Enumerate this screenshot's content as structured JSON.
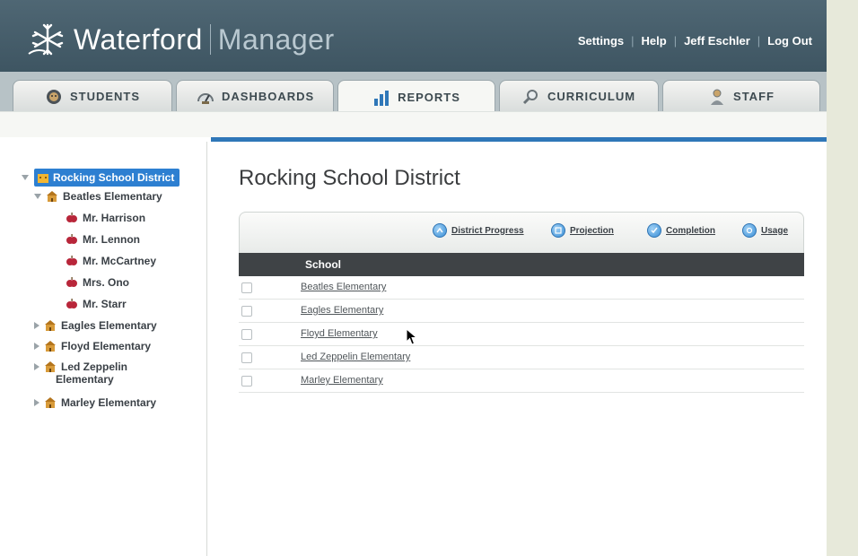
{
  "header": {
    "brand_primary": "Waterford",
    "brand_secondary": "Manager",
    "util_links": [
      "Settings",
      "Help",
      "Jeff Eschler",
      "Log Out"
    ]
  },
  "tabs": [
    {
      "label": "STUDENTS",
      "icon": "face-icon"
    },
    {
      "label": "DASHBOARDS",
      "icon": "gauge-icon"
    },
    {
      "label": "REPORTS",
      "icon": "bar-chart-icon",
      "active": true
    },
    {
      "label": "CURRICULUM",
      "icon": "magnifier-icon"
    },
    {
      "label": "STAFF",
      "icon": "person-icon"
    }
  ],
  "sidebar": {
    "district": "Rocking School District",
    "schools": [
      {
        "label": "Beatles Elementary",
        "expanded": true,
        "teachers": [
          "Mr. Harrison",
          "Mr. Lennon",
          "Mr. McCartney",
          "Mrs. Ono",
          "Mr. Starr"
        ]
      },
      {
        "label": "Eagles Elementary",
        "expanded": false
      },
      {
        "label": "Floyd Elementary",
        "expanded": false
      },
      {
        "label_line1": "Led Zeppelin",
        "label_line2": "Elementary",
        "expanded": false
      },
      {
        "label": "Marley Elementary",
        "expanded": false
      }
    ]
  },
  "main": {
    "title": "Rocking School District",
    "report_links": [
      "District Progress",
      "Projection",
      "Completion",
      "Usage"
    ],
    "table": {
      "column_header": "School",
      "rows": [
        "Beatles Elementary",
        "Eagles Elementary",
        "Floyd Elementary",
        "Led Zeppelin Elementary",
        "Marley Elementary"
      ]
    }
  },
  "colors": {
    "header_bg": "#46606c",
    "accent_blue": "#2f77b8",
    "selected_node": "#2d7fd1",
    "table_header_bg": "#3f4346"
  }
}
